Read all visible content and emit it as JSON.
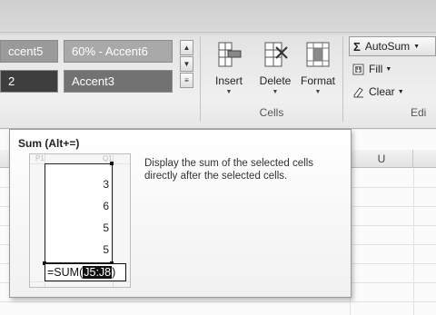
{
  "ribbon": {
    "cell_styles": {
      "swatches": [
        "ccent5",
        "60% - Accent6",
        "2",
        "Accent3"
      ]
    },
    "cells_group": {
      "label": "Cells",
      "insert_label": "Insert",
      "delete_label": "Delete",
      "format_label": "Format"
    },
    "editing_group": {
      "label": "Edi",
      "autosum_label": "AutoSum",
      "fill_label": "Fill",
      "clear_label": "Clear"
    }
  },
  "sheet": {
    "column_header": "U"
  },
  "tooltip": {
    "title": "Sum (Alt+=)",
    "description": "Display the sum of the selected cells directly after the selected cells.",
    "preview": {
      "col_left": "P1",
      "col_right": "Q1",
      "values": [
        "3",
        "6",
        "5",
        "5"
      ],
      "formula_prefix": "=SUM(",
      "formula_ref": "J5:J8",
      "formula_suffix": ")"
    }
  },
  "colors": {
    "swatch_light": "#9a9a9a",
    "swatch_dark": "#3e3e3e",
    "tooltip_border": "#9a9a9a"
  },
  "icons": [
    "insert-cells-icon",
    "delete-cells-icon",
    "format-cells-icon",
    "sigma-icon",
    "fill-down-icon",
    "eraser-icon",
    "chevron-down-icon",
    "scroll-up-icon",
    "scroll-down-icon",
    "gallery-more-icon"
  ]
}
